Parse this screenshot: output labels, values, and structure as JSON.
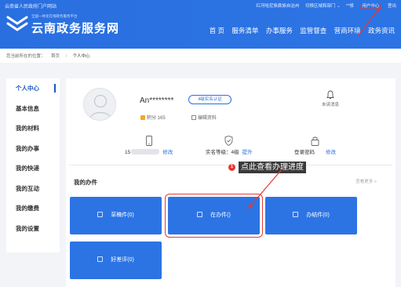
{
  "header": {
    "portal_link": "云南省人民政府门户网站",
    "top_links": [
      "红河哈尼族彝族自治州",
      "切换区域和部门 ⌄",
      "**修",
      "用户中心",
      "登出"
    ],
    "logo_subtitle": "全国一体化在线政务服务平台",
    "logo_title": "云南政务服务网",
    "nav": [
      "首 页",
      "服务清单",
      "办事服务",
      "监管督查",
      "营商环境",
      "政务资讯"
    ]
  },
  "breadcrumb": {
    "label": "您当前所在的位置：",
    "home": "首页",
    "sep": "/",
    "current": "个人中心"
  },
  "sidebar": {
    "items": [
      "个人中心",
      "基本信息",
      "我的材料",
      "我的办事",
      "我的快递",
      "我的互动",
      "我的缴费",
      "我的设置"
    ],
    "active": 0
  },
  "profile": {
    "name": "An********",
    "verify_badge": "4级实名认证",
    "points": "积分 165",
    "edit": "编辑资料",
    "unread": "未读消息"
  },
  "stats": {
    "phone_prefix": "15",
    "phone_action": "修改",
    "level_label": "实名等级：4级",
    "level_action": "提升",
    "password_label": "登录密码",
    "password_action": "修改"
  },
  "jobs": {
    "title": "我的办件",
    "view_more": "查看更多 >",
    "cards": [
      "草稿件(0)",
      "在办件()",
      "办结件(0)",
      "好差评(0)"
    ]
  },
  "annotation": {
    "number": "1",
    "text": "点此查看办理进度"
  },
  "colors": {
    "primary": "#2c74e4",
    "annotation_red": "#e53935"
  }
}
